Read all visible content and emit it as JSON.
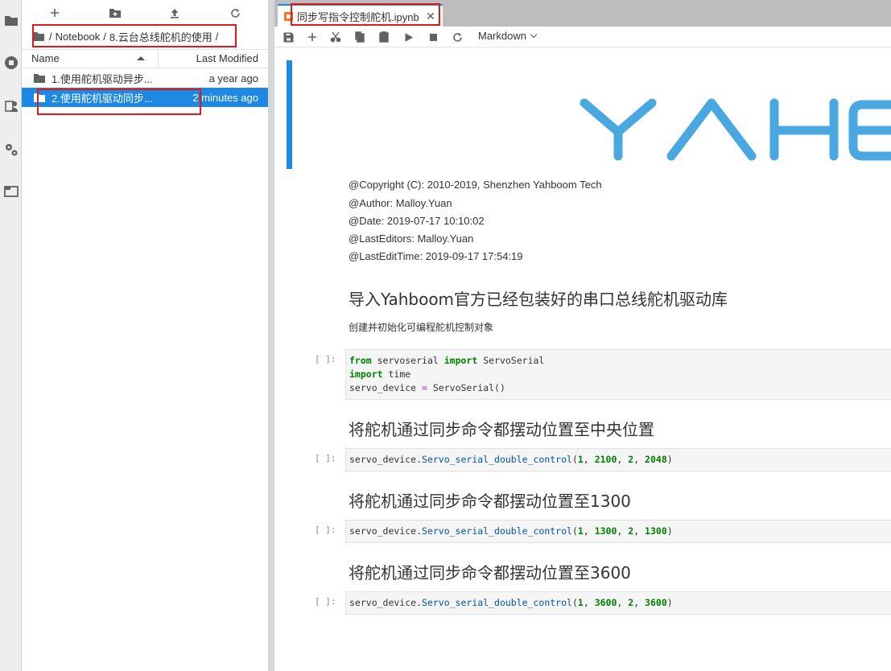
{
  "filebrowser": {
    "breadcrumb": [
      "/",
      "Notebook",
      "/",
      "8.云台总线舵机的使用",
      "/"
    ],
    "columns": {
      "name": "Name",
      "modified": "Last Modified"
    },
    "items": [
      {
        "name": "1.使用舵机驱动异步...",
        "modified": "a year ago",
        "type": "folder",
        "selected": false
      },
      {
        "name": "2.使用舵机驱动同步...",
        "modified": "2 minutes ago",
        "type": "folder",
        "selected": true
      }
    ]
  },
  "tab": {
    "title": "同步写指令控制舵机.ipynb",
    "close": "✕"
  },
  "toolbar": {
    "cell_type": "Markdown"
  },
  "logo_text": "YAHB",
  "meta": [
    "@Copyright (C): 2010-2019, Shenzhen Yahboom Tech",
    "@Author: Malloy.Yuan",
    "@Date: 2019-07-17 10:10:02",
    "@LastEditors: Malloy.Yuan",
    "@LastEditTime: 2019-09-17 17:54:19"
  ],
  "cells": {
    "h1": "导入Yahboom官方已经包装好的串口总线舵机驱动库",
    "p1": "创建并初始化可编程舵机控制对象",
    "h2": "将舵机通过同步命令都摆动位置至中央位置",
    "h3": "将舵机通过同步命令都摆动位置至1300",
    "h4": "将舵机通过同步命令都摆动位置至3600",
    "prompt": "[ ]:"
  },
  "code": {
    "c1": {
      "l1": {
        "kw1": "from",
        "mod": " servoserial ",
        "kw2": "import",
        "rest": " ServoSerial"
      },
      "l2": {
        "kw": "import",
        "rest": " time"
      },
      "l3": {
        "a": "servo_device ",
        "op": "=",
        "b": " ServoSerial()"
      }
    },
    "calls": [
      {
        "obj": "servo_device.",
        "fn": "Servo_serial_double_control",
        "a1": "1",
        "a2": "2100",
        "a3": "2",
        "a4": "2048"
      },
      {
        "obj": "servo_device.",
        "fn": "Servo_serial_double_control",
        "a1": "1",
        "a2": "1300",
        "a3": "2",
        "a4": "1300"
      },
      {
        "obj": "servo_device.",
        "fn": "Servo_serial_double_control",
        "a1": "1",
        "a2": "3600",
        "a3": "2",
        "a4": "3600"
      }
    ],
    "punct": {
      "open": "(",
      "comma": ", ",
      "close": ")"
    }
  }
}
